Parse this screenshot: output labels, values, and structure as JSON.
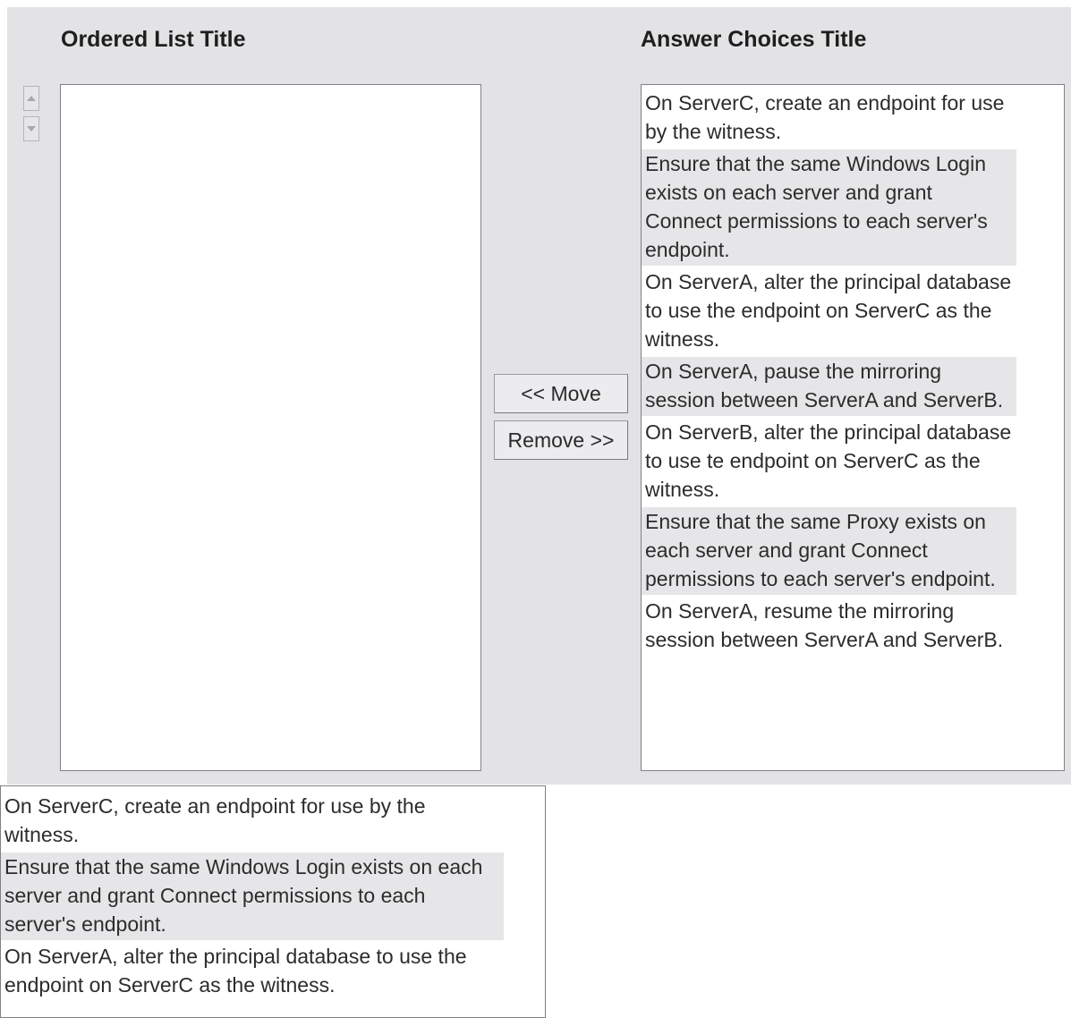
{
  "ordered_list": {
    "title": "Ordered List Title",
    "items": []
  },
  "answer_choices": {
    "title": "Answer Choices Title",
    "items": [
      "On ServerC, create an endpoint for use by the witness.",
      "Ensure that the same Windows Login exists on each server and grant Connect permissions to each server's endpoint.",
      "On ServerA, alter the principal database to use the endpoint on ServerC as the witness.",
      "On ServerA, pause the mirroring session between ServerA and ServerB.",
      "On ServerB, alter the principal database to use te endpoint on ServerC as the witness.",
      "Ensure that the same Proxy exists on each server and grant Connect permissions to each server's endpoint.",
      "On ServerA, resume the mirroring session between ServerA and ServerB."
    ]
  },
  "buttons": {
    "move_label": "<< Move",
    "remove_label": "Remove >>",
    "up_icon": "arrow-up-icon",
    "down_icon": "arrow-down-icon"
  },
  "bottom_list": {
    "items": [
      "On ServerC, create an endpoint for use by the witness.",
      "Ensure that the same Windows Login exists on each server and grant Connect permissions to each server's endpoint.",
      "On ServerA, alter the principal database to use the endpoint on ServerC as the witness."
    ]
  },
  "colors": {
    "panel_background": "#e3e3e6",
    "shaded_item": "#e6e6e8"
  }
}
